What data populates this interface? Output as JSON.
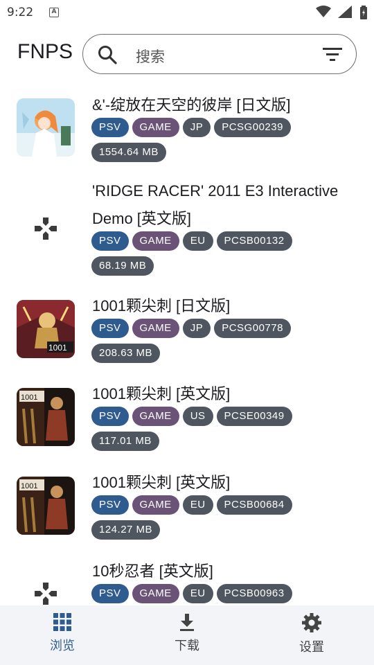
{
  "status_bar": {
    "time": "9:22",
    "notification": "A"
  },
  "header": {
    "app_title": "FNPS",
    "search_placeholder": "搜索"
  },
  "items": [
    {
      "title": "&'-绽放在天空的彼岸 [日文版]",
      "platform": "PSV",
      "type": "GAME",
      "region": "JP",
      "id": "PCSG00239",
      "size": "1554.64 MB",
      "thumb": "anime"
    },
    {
      "title": "'RIDGE RACER' 2011 E3 Interactive Demo [英文版]",
      "platform": "PSV",
      "type": "GAME",
      "region": "EU",
      "id": "PCSB00132",
      "size": "68.19 MB",
      "thumb": "gamepad"
    },
    {
      "title": "1001颗尖刺 [日文版]",
      "platform": "PSV",
      "type": "GAME",
      "region": "JP",
      "id": "PCSG00778",
      "size": "208.63 MB",
      "thumb": "spikes-jp"
    },
    {
      "title": "1001颗尖刺 [英文版]",
      "platform": "PSV",
      "type": "GAME",
      "region": "US",
      "id": "PCSE00349",
      "size": "117.01 MB",
      "thumb": "spikes"
    },
    {
      "title": "1001颗尖刺 [英文版]",
      "platform": "PSV",
      "type": "GAME",
      "region": "EU",
      "id": "PCSB00684",
      "size": "124.27 MB",
      "thumb": "spikes"
    },
    {
      "title": "10秒忍者 [英文版]",
      "platform": "PSV",
      "type": "GAME",
      "region": "EU",
      "id": "PCSB00963",
      "size": "",
      "thumb": "gamepad"
    }
  ],
  "bottom_nav": [
    {
      "label": "浏览",
      "icon": "grid-icon",
      "active": true
    },
    {
      "label": "下载",
      "icon": "download-icon",
      "active": false
    },
    {
      "label": "设置",
      "icon": "settings-icon",
      "active": false
    }
  ],
  "colors": {
    "psv": "#2f5c8f",
    "game": "#6b5378",
    "tag": "#4f5660",
    "accent": "#2f5c8f"
  }
}
